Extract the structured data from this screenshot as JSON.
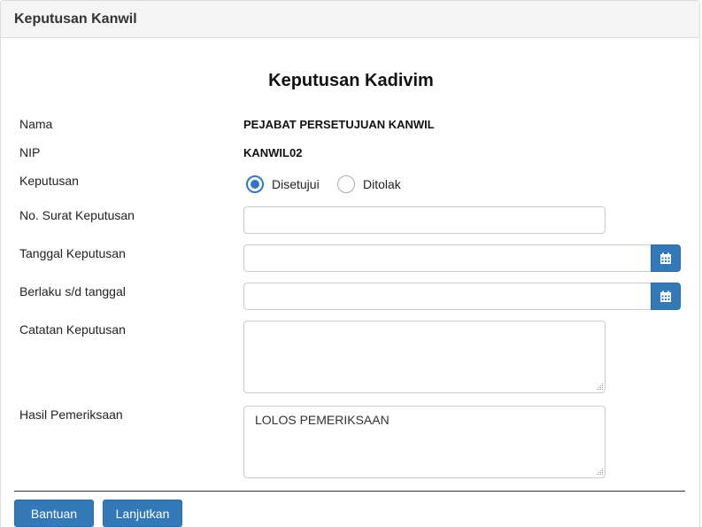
{
  "panel": {
    "title": "Keputusan Kanwil"
  },
  "form": {
    "title": "Keputusan Kadivim",
    "nama": {
      "label": "Nama",
      "value": "PEJABAT PERSETUJUAN KANWIL"
    },
    "nip": {
      "label": "NIP",
      "value": "KANWIL02"
    },
    "keputusan": {
      "label": "Keputusan",
      "options": [
        {
          "label": "Disetujui",
          "checked": true
        },
        {
          "label": "Ditolak",
          "checked": false
        }
      ]
    },
    "no_surat": {
      "label": "No. Surat Keputusan",
      "value": ""
    },
    "tanggal": {
      "label": "Tanggal Keputusan",
      "value": "",
      "icon": "calendar-icon"
    },
    "berlaku": {
      "label": "Berlaku s/d tanggal",
      "value": "",
      "icon": "calendar-icon"
    },
    "catatan": {
      "label": "Catatan Keputusan",
      "value": ""
    },
    "hasil": {
      "label": "Hasil Pemeriksaan",
      "value": "LOLOS PEMERIKSAAN"
    }
  },
  "footer": {
    "help_label": "Bantuan",
    "next_label": "Lanjutkan"
  },
  "colors": {
    "primary": "#3379b7",
    "radio_checked": "#2f78c4",
    "heading_bg": "#f5f5f5"
  }
}
